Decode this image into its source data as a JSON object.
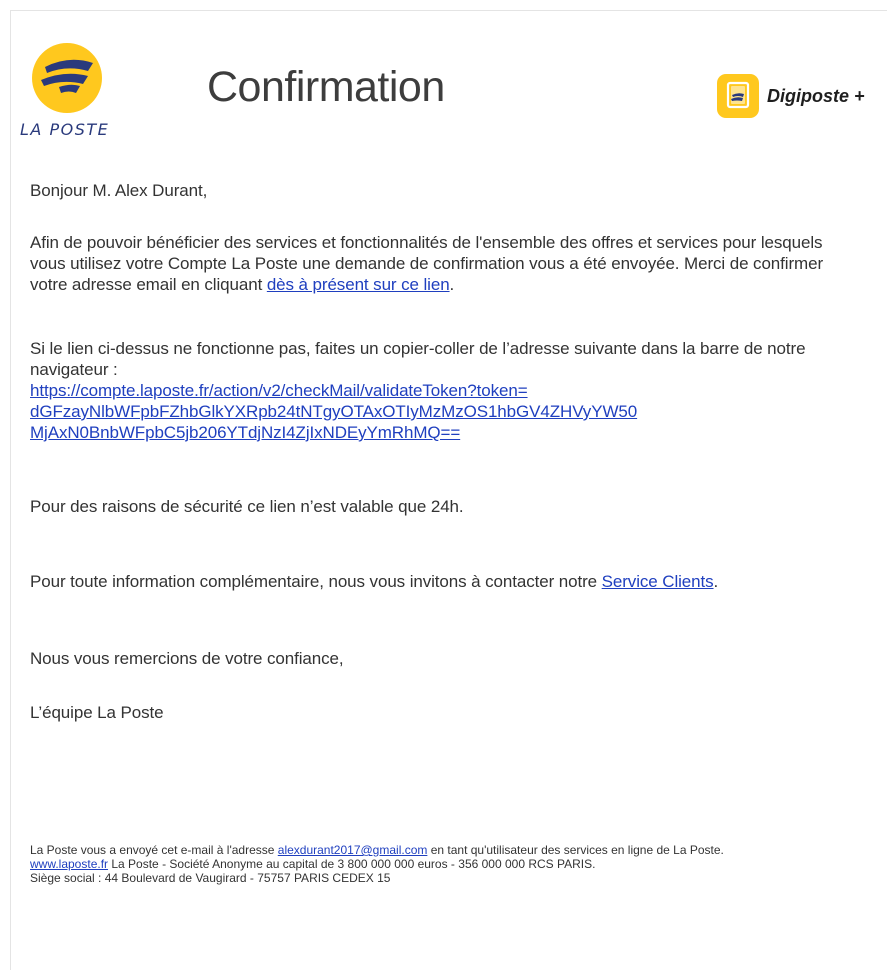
{
  "header": {
    "logo_text": "LA POSTE",
    "title": "Confirmation",
    "digiposte_label": "Digiposte +"
  },
  "body": {
    "greeting": "Bonjour M. Alex Durant,",
    "para1_text": "Afin de pouvoir bénéficier des services et fonctionnalités de l'ensemble des offres et services pour lesquels vous utilisez votre Compte La Poste une demande de confirmation vous a été envoyée. Merci de confirmer votre adresse email en cliquant ",
    "para1_link": "dès à présent sur ce lien",
    "para1_end": ".",
    "para2_text": "Si le lien ci-dessus ne fonctionne pas, faites un copier-coller de l’adresse suivante dans la barre de notre navigateur :",
    "url_line1": "https://compte.laposte.fr/action/v2/checkMail/validateToken?token=",
    "url_line2": "dGFzayNlbWFpbFZhbGlkYXRpb24tNTgyOTAxOTIyMzMzOS1hbGV4ZHVyYW50",
    "url_line3": "MjAxN0BnbWFpbC5jb206YTdjNzI4ZjIxNDEyYmRhMQ==",
    "para3": "Pour des raisons de sécurité ce lien n’est valable que 24h.",
    "para4_text": "Pour toute information complémentaire, nous vous invitons à contacter notre ",
    "para4_link": "Service Clients",
    "para4_end": ".",
    "para5": "Nous vous remercions de votre confiance,",
    "signature": "L’équipe La Poste"
  },
  "footer": {
    "line1_prefix": "La Poste vous a envoyé cet e-mail à l'adresse ",
    "email_link": "alexdurant2017@gmail.com",
    "line1_suffix": " en tant qu'utilisateur des services en ligne de La Poste.",
    "site_link": "www.laposte.fr",
    "line2_suffix": " La Poste - Société Anonyme au capital de 3 800 000 000 euros - 356 000 000 RCS PARIS.",
    "line3": "Siège social : 44 Boulevard de Vaugirard - 75757 PARIS CEDEX 15"
  },
  "colors": {
    "link": "#1f3fbf",
    "logo_yellow": "#ffc81e",
    "logo_blue": "#2a3a7c",
    "text": "#333333"
  },
  "icons": {
    "la_poste_logo": "la-poste-logo-icon",
    "digiposte": "digiposte-icon"
  }
}
